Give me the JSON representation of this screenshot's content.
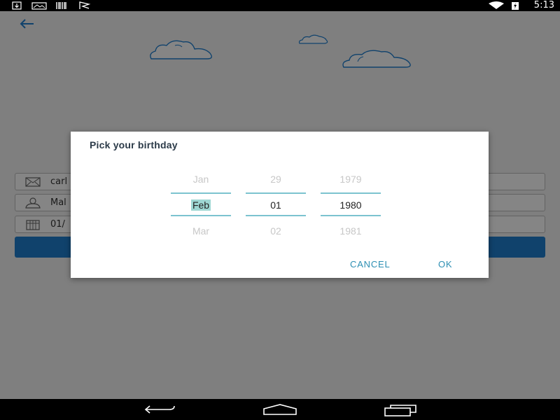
{
  "status_bar": {
    "time": "5:13",
    "icons": [
      "download-icon",
      "photo-icon",
      "barcode-icon",
      "flag-icon",
      "wifi-icon",
      "battery-icon"
    ]
  },
  "app": {
    "fields": [
      {
        "icon": "mail-icon",
        "value": "carl"
      },
      {
        "icon": "person-icon",
        "value": "Mal"
      },
      {
        "icon": "calendar-icon",
        "value": "01/"
      }
    ],
    "colors": {
      "accent": "#1f7fd0",
      "cloud_stroke": "#1f7fd0"
    }
  },
  "dialog": {
    "title": "Pick your birthday",
    "month": {
      "prev": "Jan",
      "current": "Feb",
      "next": "Mar"
    },
    "day": {
      "prev": "29",
      "current": "01",
      "next": "02"
    },
    "year": {
      "prev": "1979",
      "current": "1980",
      "next": "1981"
    },
    "cancel_label": "CANCEL",
    "ok_label": "OK",
    "colors": {
      "divider": "#7cc3cf",
      "button_text": "#2d8fb3",
      "selection_highlight": "#9fd7d3"
    }
  },
  "nav_bar": {
    "icons": [
      "back-nav-icon",
      "home-nav-icon",
      "recents-nav-icon"
    ]
  }
}
